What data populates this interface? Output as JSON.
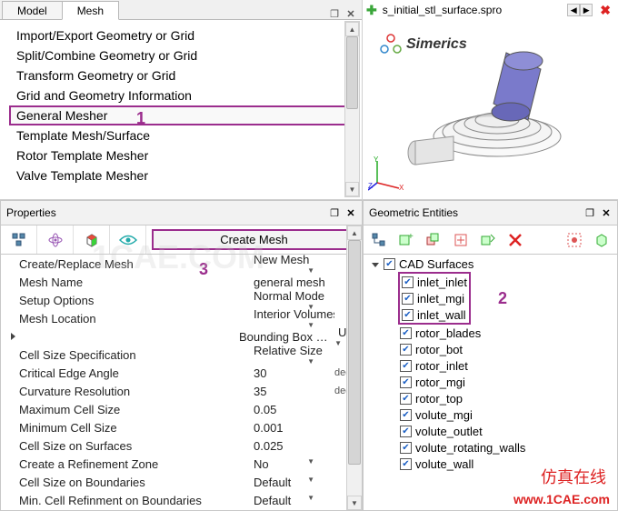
{
  "mesh_panel": {
    "tabs": [
      "Model",
      "Mesh"
    ],
    "active_tab": 1,
    "items": [
      "Import/Export Geometry or Grid",
      "Split/Combine Geometry or Grid",
      "Transform Geometry or Grid",
      "Grid and Geometry Information",
      "General Mesher",
      "Template Mesh/Surface",
      "Rotor Template Mesher",
      "Valve Template Mesher"
    ],
    "selected_index": 4,
    "annot_1": "1"
  },
  "viewport": {
    "file_title": "s_initial_stl_surface.spro",
    "brand": "Simerics"
  },
  "properties": {
    "header": "Properties",
    "create_mesh_label": "Create Mesh",
    "annot_3": "3",
    "rows": [
      {
        "name": "Create/Replace Mesh",
        "value": "New Mesh",
        "dropdown": true
      },
      {
        "name": "Mesh Name",
        "value": "general mesh"
      },
      {
        "name": "Setup Options",
        "value": "Normal Mode",
        "dropdown": true
      },
      {
        "name": "Mesh Location",
        "value": "Interior Volumes",
        "dropdown": true
      },
      {
        "name": "Bounding Box Margins",
        "value": "Uniform",
        "dropdown": true,
        "expandable": true
      },
      {
        "name": "Cell Size Specification",
        "value": "Relative Size",
        "dropdown": true
      },
      {
        "name": "Critical Edge Angle",
        "value": "30",
        "unit": "deg"
      },
      {
        "name": "Curvature Resolution",
        "value": "35",
        "unit": "deg"
      },
      {
        "name": "Maximum Cell Size",
        "value": "0.05"
      },
      {
        "name": "Minimum Cell Size",
        "value": "0.001"
      },
      {
        "name": "Cell Size on Surfaces",
        "value": "0.025"
      },
      {
        "name": "Create a Refinement Zone",
        "value": "No",
        "dropdown": true
      },
      {
        "name": "Cell Size on Boundaries",
        "value": "Default",
        "dropdown": true
      },
      {
        "name": "Min. Cell Refinment on Boundaries",
        "value": "Default",
        "dropdown": true
      }
    ]
  },
  "entities": {
    "header": "Geometric Entities",
    "root": "CAD Surfaces",
    "annot_2": "2",
    "boxed_items": [
      "inlet_inlet",
      "inlet_mgi",
      "inlet_wall"
    ],
    "items": [
      "rotor_blades",
      "rotor_bot",
      "rotor_inlet",
      "rotor_mgi",
      "rotor_top",
      "volute_mgi",
      "volute_outlet",
      "volute_rotating_walls",
      "volute_wall"
    ]
  },
  "watermark": {
    "url": "www.1CAE.com",
    "cn": "仿真在线"
  }
}
